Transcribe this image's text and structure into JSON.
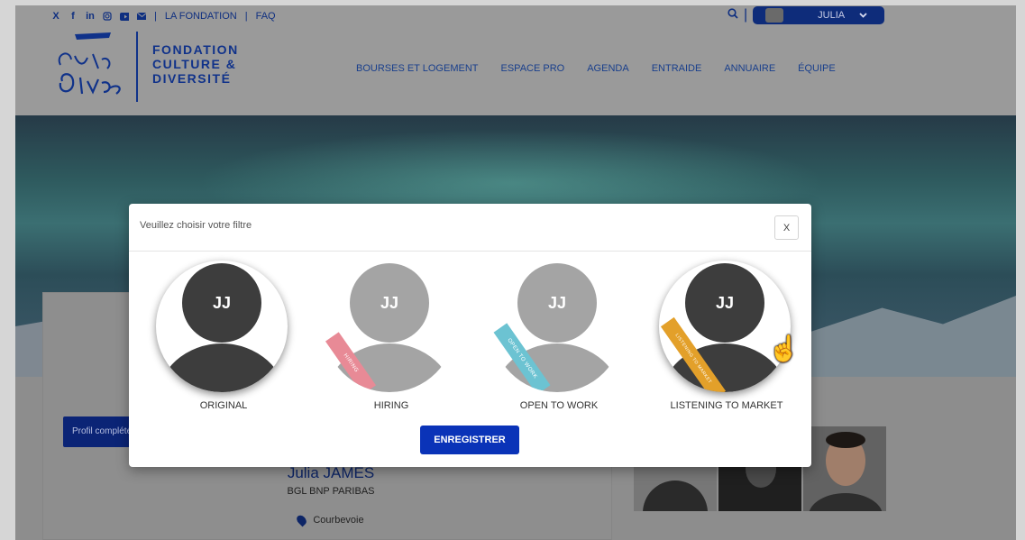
{
  "header": {
    "social_icons": [
      "x-icon",
      "facebook-icon",
      "linkedin-icon",
      "instagram-icon",
      "youtube-icon",
      "email-icon"
    ],
    "links": [
      "LA FONDATION",
      "FAQ"
    ],
    "user_name": "JULIA",
    "logo_text": "FONDATION\nCULTURE &\nDIVERSITÉ",
    "logo_script": "culture Diversité",
    "nav": [
      "BOURSES ET LOGEMENT",
      "ESPACE PRO",
      "AGENDA",
      "ENTRAIDE",
      "ANNUAIRE",
      "ÉQUIPE"
    ]
  },
  "profile": {
    "button_label": "Profil complété",
    "name": "Julia JAMES",
    "company": "BGL BNP PARIBAS",
    "location": "Courbevoie"
  },
  "modal": {
    "title": "Veuillez choisir votre filtre",
    "close_label": "X",
    "options": [
      {
        "initials": "JJ",
        "label": "ORIGINAL",
        "ribbon": ""
      },
      {
        "initials": "JJ",
        "label": "HIRING",
        "ribbon": "HIRING"
      },
      {
        "initials": "JJ",
        "label": "OPEN TO WORK",
        "ribbon": "OPEN TO WORK"
      },
      {
        "initials": "JJ",
        "label": "LISTENING TO MARKET",
        "ribbon": "LISTENING TO MARKET"
      }
    ],
    "save_label": "ENREGISTRER"
  },
  "colors": {
    "brand_blue": "#10328a",
    "save_button": "#0a33b8",
    "ribbon_hiring": "#e88a96",
    "ribbon_open": "#6cc3d2",
    "ribbon_market": "#e3a02a"
  }
}
